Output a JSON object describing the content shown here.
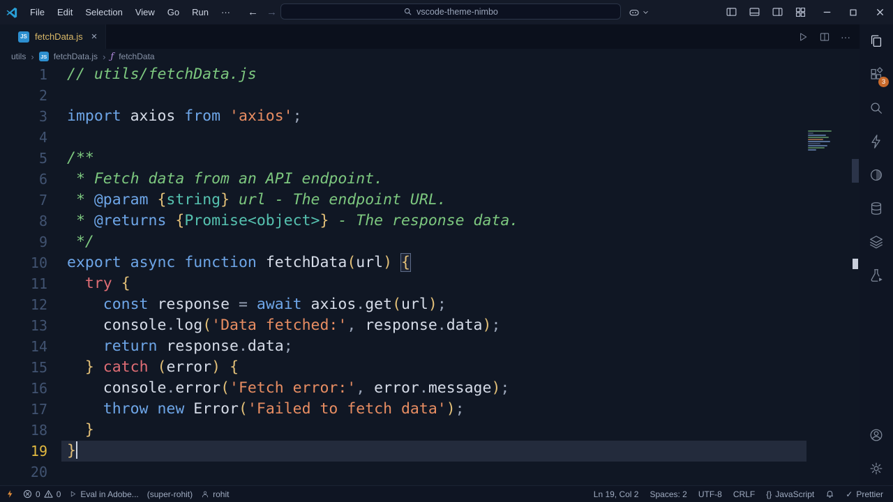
{
  "colors": {
    "editor_bg": "#101724",
    "titlebar_bg": "#141a28",
    "tabbar_bg": "#0b101c",
    "keyword_blue": "#6ea6e8",
    "comment_green": "#7dc87f",
    "string_orange": "#e88d62",
    "punct_yellow": "#e3c078",
    "type_teal": "#56c2b0",
    "control_coral": "#e06d75",
    "active_line_bg": "#232b3c",
    "badge_orange": "#c96a2b",
    "tab_label_gold": "#d9b868"
  },
  "icons": {
    "close": "×",
    "back": "←",
    "forward": "→",
    "check": "✓",
    "braces": "{}",
    "overflow": "···",
    "separator": "›",
    "fn_symbol": "ƒ",
    "js_badge": "JS"
  },
  "title_bar": {
    "menus": [
      "File",
      "Edit",
      "Selection",
      "View",
      "Go",
      "Run",
      "···"
    ],
    "search_text": "vscode-theme-nimbo"
  },
  "tab_bar": {
    "tabs": [
      {
        "label": "fetchData.js"
      }
    ]
  },
  "breadcrumb": {
    "items": [
      "utils",
      "fetchData.js",
      "fetchData"
    ]
  },
  "editor": {
    "active_line": 19,
    "cursor": {
      "line": 19,
      "col": 2
    },
    "lines": [
      {
        "n": 1,
        "tokens": [
          [
            "c",
            "// utils/fetchData.js"
          ]
        ]
      },
      {
        "n": 2,
        "tokens": []
      },
      {
        "n": 3,
        "tokens": [
          [
            "k",
            "import"
          ],
          [
            "p",
            " axios "
          ],
          [
            "k",
            "from"
          ],
          [
            "p",
            " "
          ],
          [
            "s",
            "'axios'"
          ],
          [
            "g",
            ";"
          ]
        ]
      },
      {
        "n": 4,
        "tokens": []
      },
      {
        "n": 5,
        "tokens": [
          [
            "c",
            "/**"
          ]
        ]
      },
      {
        "n": 6,
        "tokens": [
          [
            "c",
            " * Fetch data from an API endpoint."
          ]
        ]
      },
      {
        "n": 7,
        "tokens": [
          [
            "c",
            " * "
          ],
          [
            "k",
            "@param"
          ],
          [
            "c",
            " "
          ],
          [
            "y",
            "{"
          ],
          [
            "t",
            "string"
          ],
          [
            "y",
            "}"
          ],
          [
            "c",
            " url - The endpoint URL."
          ]
        ]
      },
      {
        "n": 8,
        "tokens": [
          [
            "c",
            " * "
          ],
          [
            "k",
            "@returns"
          ],
          [
            "c",
            " "
          ],
          [
            "y",
            "{"
          ],
          [
            "t",
            "Promise<object>"
          ],
          [
            "y",
            "}"
          ],
          [
            "c",
            " - The response data."
          ]
        ]
      },
      {
        "n": 9,
        "tokens": [
          [
            "c",
            " */"
          ]
        ]
      },
      {
        "n": 10,
        "tokens": [
          [
            "k",
            "export"
          ],
          [
            "p",
            " "
          ],
          [
            "k",
            "async"
          ],
          [
            "p",
            " "
          ],
          [
            "k",
            "function"
          ],
          [
            "p",
            " fetchData"
          ],
          [
            "y",
            "("
          ],
          [
            "p",
            "url"
          ],
          [
            "y",
            ")"
          ],
          [
            "p",
            " "
          ],
          [
            "m",
            "{"
          ]
        ]
      },
      {
        "n": 11,
        "tokens": [
          [
            "p",
            "  "
          ],
          [
            "r",
            "try"
          ],
          [
            "p",
            " "
          ],
          [
            "y",
            "{"
          ]
        ]
      },
      {
        "n": 12,
        "tokens": [
          [
            "p",
            "    "
          ],
          [
            "k",
            "const"
          ],
          [
            "p",
            " response "
          ],
          [
            "g",
            "="
          ],
          [
            "p",
            " "
          ],
          [
            "k",
            "await"
          ],
          [
            "p",
            " axios"
          ],
          [
            "g",
            "."
          ],
          [
            "p",
            "get"
          ],
          [
            "y",
            "("
          ],
          [
            "p",
            "url"
          ],
          [
            "y",
            ")"
          ],
          [
            "g",
            ";"
          ]
        ]
      },
      {
        "n": 13,
        "tokens": [
          [
            "p",
            "    console"
          ],
          [
            "g",
            "."
          ],
          [
            "p",
            "log"
          ],
          [
            "y",
            "("
          ],
          [
            "s",
            "'Data fetched:'"
          ],
          [
            "g",
            ","
          ],
          [
            "p",
            " response"
          ],
          [
            "g",
            "."
          ],
          [
            "p",
            "data"
          ],
          [
            "y",
            ")"
          ],
          [
            "g",
            ";"
          ]
        ]
      },
      {
        "n": 14,
        "tokens": [
          [
            "p",
            "    "
          ],
          [
            "k",
            "return"
          ],
          [
            "p",
            " response"
          ],
          [
            "g",
            "."
          ],
          [
            "p",
            "data"
          ],
          [
            "g",
            ";"
          ]
        ]
      },
      {
        "n": 15,
        "tokens": [
          [
            "p",
            "  "
          ],
          [
            "y",
            "}"
          ],
          [
            "p",
            " "
          ],
          [
            "r",
            "catch"
          ],
          [
            "p",
            " "
          ],
          [
            "y",
            "("
          ],
          [
            "p",
            "error"
          ],
          [
            "y",
            ")"
          ],
          [
            "p",
            " "
          ],
          [
            "y",
            "{"
          ]
        ]
      },
      {
        "n": 16,
        "tokens": [
          [
            "p",
            "    console"
          ],
          [
            "g",
            "."
          ],
          [
            "p",
            "error"
          ],
          [
            "y",
            "("
          ],
          [
            "s",
            "'Fetch error:'"
          ],
          [
            "g",
            ","
          ],
          [
            "p",
            " error"
          ],
          [
            "g",
            "."
          ],
          [
            "p",
            "message"
          ],
          [
            "y",
            ")"
          ],
          [
            "g",
            ";"
          ]
        ]
      },
      {
        "n": 17,
        "tokens": [
          [
            "p",
            "    "
          ],
          [
            "k",
            "throw"
          ],
          [
            "p",
            " "
          ],
          [
            "k",
            "new"
          ],
          [
            "p",
            " Error"
          ],
          [
            "y",
            "("
          ],
          [
            "s",
            "'Failed to fetch data'"
          ],
          [
            "y",
            ")"
          ],
          [
            "g",
            ";"
          ]
        ]
      },
      {
        "n": 18,
        "tokens": [
          [
            "p",
            "  "
          ],
          [
            "y",
            "}"
          ]
        ]
      },
      {
        "n": 19,
        "tokens": [
          [
            "y",
            "}"
          ]
        ]
      },
      {
        "n": 20,
        "tokens": []
      }
    ]
  },
  "activity_bar": {
    "badge_count": "3"
  },
  "status_bar": {
    "error_count": "0",
    "warning_count": "0",
    "task": "Eval in Adobe...",
    "env": "(super-rohit)",
    "branch": "rohit",
    "line_col": "Ln 19, Col 2",
    "indent": "Spaces: 2",
    "encoding": "UTF-8",
    "eol": "CRLF",
    "language": "JavaScript",
    "formatter": "Prettier"
  }
}
